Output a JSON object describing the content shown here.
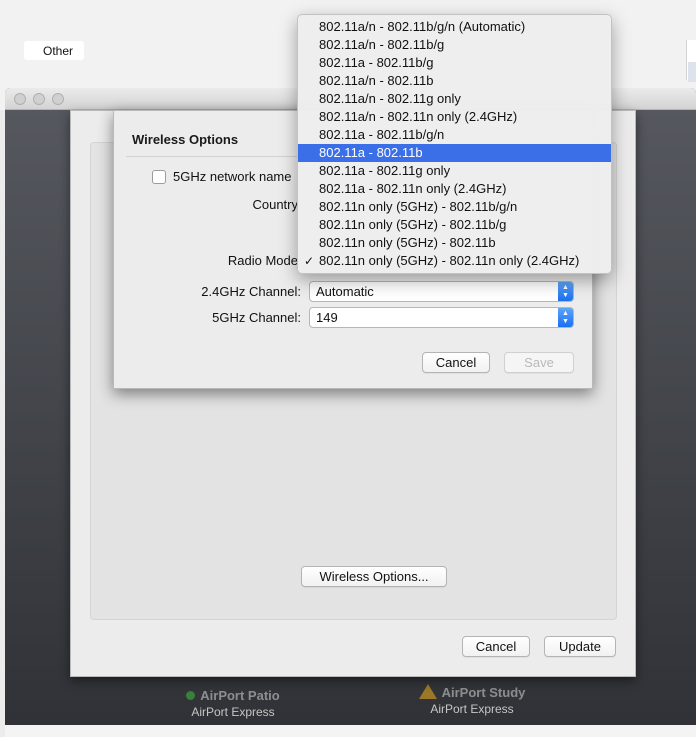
{
  "sidebar": {
    "other_label": "Other"
  },
  "devices": [
    {
      "name": "AirPort Patio",
      "type": "AirPort Express",
      "status": "ok"
    },
    {
      "name": "AirPort Study",
      "type": "AirPort Express",
      "status": "warning"
    }
  ],
  "settings_sheet": {
    "wireless_options_button": "Wireless Options...",
    "cancel_label": "Cancel",
    "update_label": "Update"
  },
  "wireless_options": {
    "title": "Wireless Options",
    "network_name_5ghz_label": "5GHz network name",
    "country_label": "Country",
    "radio_mode_label": "Radio Mode",
    "channel_24_label": "2.4GHz Channel:",
    "channel_24_value": "Automatic",
    "channel_5_label": "5GHz Channel:",
    "channel_5_value": "149",
    "cancel_label": "Cancel",
    "save_label": "Save"
  },
  "radio_mode_menu": {
    "checkmark": "✓",
    "items": [
      "802.11a/n - 802.11b/g/n (Automatic)",
      "802.11a/n - 802.11b/g",
      "802.11a - 802.11b/g",
      "802.11a/n - 802.11b",
      "802.11a/n - 802.11g only",
      "802.11a/n - 802.11n only (2.4GHz)",
      "802.11a - 802.11b/g/n",
      "802.11a - 802.11b",
      "802.11a - 802.11g only",
      "802.11a - 802.11n only (2.4GHz)",
      "802.11n only (5GHz) - 802.11b/g/n",
      "802.11n only (5GHz) - 802.11b/g",
      "802.11n only (5GHz) - 802.11b",
      "802.11n only (5GHz) - 802.11n only (2.4GHz)"
    ],
    "highlighted": "802.11a - 802.11b",
    "checked": "802.11n only (5GHz) - 802.11n only (2.4GHz)"
  },
  "colors": {
    "highlight": "#3b6fe8",
    "stepper": "#1b6ff0",
    "status_ok": "#3cc13b",
    "status_warning": "#f0b21a"
  }
}
